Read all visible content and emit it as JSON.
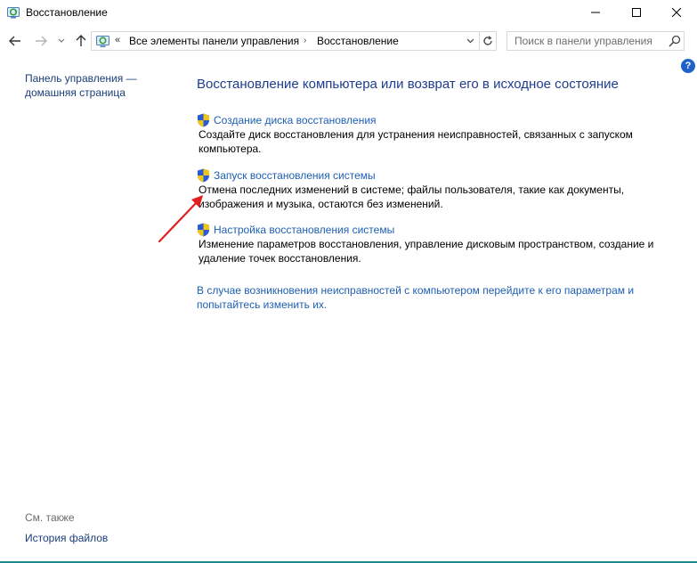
{
  "window": {
    "title": "Восстановление",
    "minimize_icon": "minimize-icon",
    "maximize_icon": "maximize-icon",
    "close_icon": "close-icon"
  },
  "address_bar": {
    "overflow_chevron": "«",
    "crumbs": [
      "Все элементы панели управления",
      "Восстановление"
    ],
    "separator": "›"
  },
  "search": {
    "placeholder": "Поиск в панели управления",
    "value": ""
  },
  "help": {
    "label": "?"
  },
  "left_pane": {
    "home_link": "Панель управления — домашняя страница",
    "see_also": "См. также",
    "file_history": "История файлов"
  },
  "main": {
    "heading": "Восстановление компьютера или возврат его в исходное состояние",
    "items": [
      {
        "title": "Создание диска восстановления",
        "description": "Создайте диск восстановления для устранения неисправностей, связанных с запуском компьютера."
      },
      {
        "title": "Запуск восстановления системы",
        "description": "Отмена последних изменений в системе; файлы пользователя, такие как документы, изображения и музыка, остаются без изменений."
      },
      {
        "title": "Настройка восстановления системы",
        "description": "Изменение параметров восстановления, управление дисковым пространством, создание и удаление точек восстановления."
      }
    ],
    "bottom_link": "В случае возникновения неисправностей с компьютером перейдите к его параметрам и попытайтесь изменить их."
  },
  "colors": {
    "link": "#1e5fb4",
    "heading": "#1e3c90",
    "annotation_arrow": "#e02020",
    "shield_blue": "#2a5bd7",
    "shield_yellow": "#f0c419"
  }
}
